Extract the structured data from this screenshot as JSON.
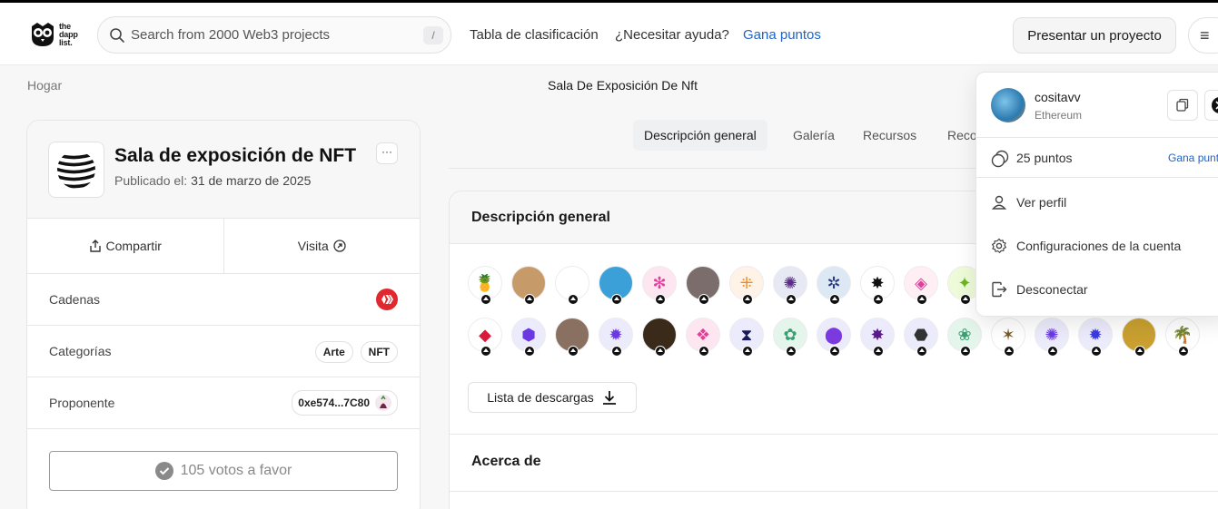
{
  "header": {
    "logo_text": [
      "the",
      "dapp",
      "list."
    ],
    "search_placeholder": "Search from 2000 Web3 projects",
    "search_shortcut": "/",
    "nav": [
      "Tabla de clasificación",
      "¿Necesitar ayuda?"
    ],
    "earn_points": "Gana puntos",
    "submit_project": "Presentar un proyecto",
    "menu_icon": "≡"
  },
  "breadcrumb": "Hogar",
  "page_title": "Sala De Exposición De Nft",
  "project": {
    "title": "Sala de exposición de NFT",
    "published_label": "Publicado el:",
    "published_date": "31 de marzo de 2025",
    "more": "···",
    "share": "Compartir",
    "visit": "Visita",
    "chains_label": "Cadenas",
    "categories_label": "Categorías",
    "categories": [
      "Arte",
      "NFT"
    ],
    "proposer_label": "Proponente",
    "proposer_address": "0xe574...7C80",
    "votes": "105 votos a favor"
  },
  "tabs": [
    "Descripción general",
    "Galería",
    "Recursos",
    "Reco"
  ],
  "overview": {
    "heading": "Descripción general",
    "download_list": "Lista de descargas",
    "about_heading": "Acerca de",
    "avatars_row1": [
      "#ffffff",
      "#c79a6a",
      "#ffffff",
      "#3ca0d8",
      "#fde6ef",
      "#7a6d6b",
      "#fff2e6",
      "#e6e8f4",
      "#dce8f4",
      "#ffffff",
      "#ffeef3",
      "#eefbd8"
    ],
    "avatars_row2": [
      "#ffffff",
      "#ecebfc",
      "#8a7060",
      "#ecebfc",
      "#3a2a1a",
      "#fde6ef",
      "#ecebfc",
      "#e4f5ec",
      "#ecebfc",
      "#ecebfc",
      "#ecebfc",
      "#e4f5ec",
      "#ffffff",
      "#ecebfc",
      "#ecebfc",
      "#c9a030",
      "#ffffff"
    ],
    "avatar_marks_row1": [
      "🍍",
      "",
      "",
      "",
      "✻",
      "",
      "⁜",
      "✺",
      "✲",
      "✸",
      "◈",
      "✦"
    ],
    "avatar_marks_row2": [
      "◆",
      "⬢",
      "",
      "✹",
      "",
      "❖",
      "⧗",
      "✿",
      "⬤",
      "✸",
      "⬣",
      "❀",
      "✶",
      "✺",
      "✹",
      "",
      "🌴"
    ],
    "avatar_colors_row1": [
      "#c03060",
      "#333",
      "#333",
      "#333",
      "#e0409a",
      "#333",
      "#f08a20",
      "#5a2a8a",
      "#2a3a7a",
      "#111",
      "#e0409a",
      "#6ab820"
    ],
    "avatar_colors_row2": [
      "#d81b3b",
      "#6a3ae0",
      "#333",
      "#6a3ae0",
      "#333",
      "#e0409a",
      "#1a1a5a",
      "#3aa070",
      "#7a3ae0",
      "#5a1a8a",
      "#333",
      "#3aa070",
      "#7a5a2a",
      "#6a3ae0",
      "#3a3ae0",
      "#333",
      "#333"
    ]
  },
  "dropdown": {
    "username": "cositavv",
    "chain": "Ethereum",
    "points": "25 puntos",
    "earn_points": "Gana punt",
    "view_profile": "Ver perfil",
    "account_settings": "Configuraciones de la cuenta",
    "logout": "Desconectar"
  },
  "colors": {
    "accent": "#1f63c7",
    "chain_badge": "#e0282e"
  }
}
